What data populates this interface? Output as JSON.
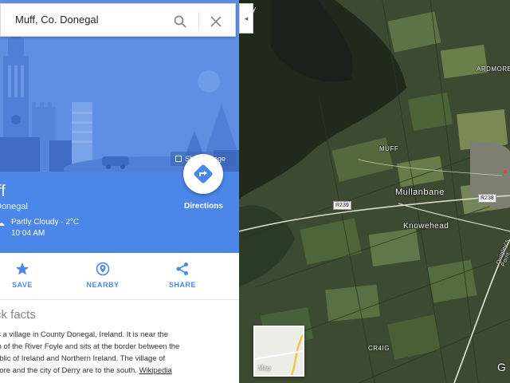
{
  "search": {
    "query": "Muff, Co. Donegal"
  },
  "hero": {
    "share_image_label": "Share image"
  },
  "place": {
    "title": "ff",
    "subtitle": "Donegal",
    "weather_icon": "☁",
    "weather": "Partly Cloudy · 2°C",
    "time": "10:04 AM",
    "directions_label": "Directions"
  },
  "actions": [
    {
      "label": "SAVE",
      "icon": "star-icon"
    },
    {
      "label": "NEARBY",
      "icon": "nearby-icon"
    },
    {
      "label": "SHARE",
      "icon": "share-icon"
    }
  ],
  "quick_facts": {
    "heading": "ck facts",
    "lines": [
      "is a village in County Donegal, Ireland. It is near the",
      "th of the River Foyle and sits at the border between the",
      "ublic of Ireland and Northern Ireland. The village of",
      "nore and the city of Derry are to the south."
    ],
    "link_label": "Wikipedia"
  },
  "collapse_label": "◂",
  "map": {
    "labels": [
      "aghy",
      "ARDMORE",
      "MUFF",
      "Mullanbane",
      "Knowehead",
      "CR4IG",
      "Quigley's Point"
    ],
    "road_shields": [
      "R239",
      "R238"
    ],
    "thumb_label": "Map",
    "google_logo": "G"
  },
  "colors": {
    "hero_blue": "#5e8fe3",
    "info_blue": "#4a87e8",
    "action_blue": "#4a87e8",
    "map_green": "#3b4a30"
  }
}
